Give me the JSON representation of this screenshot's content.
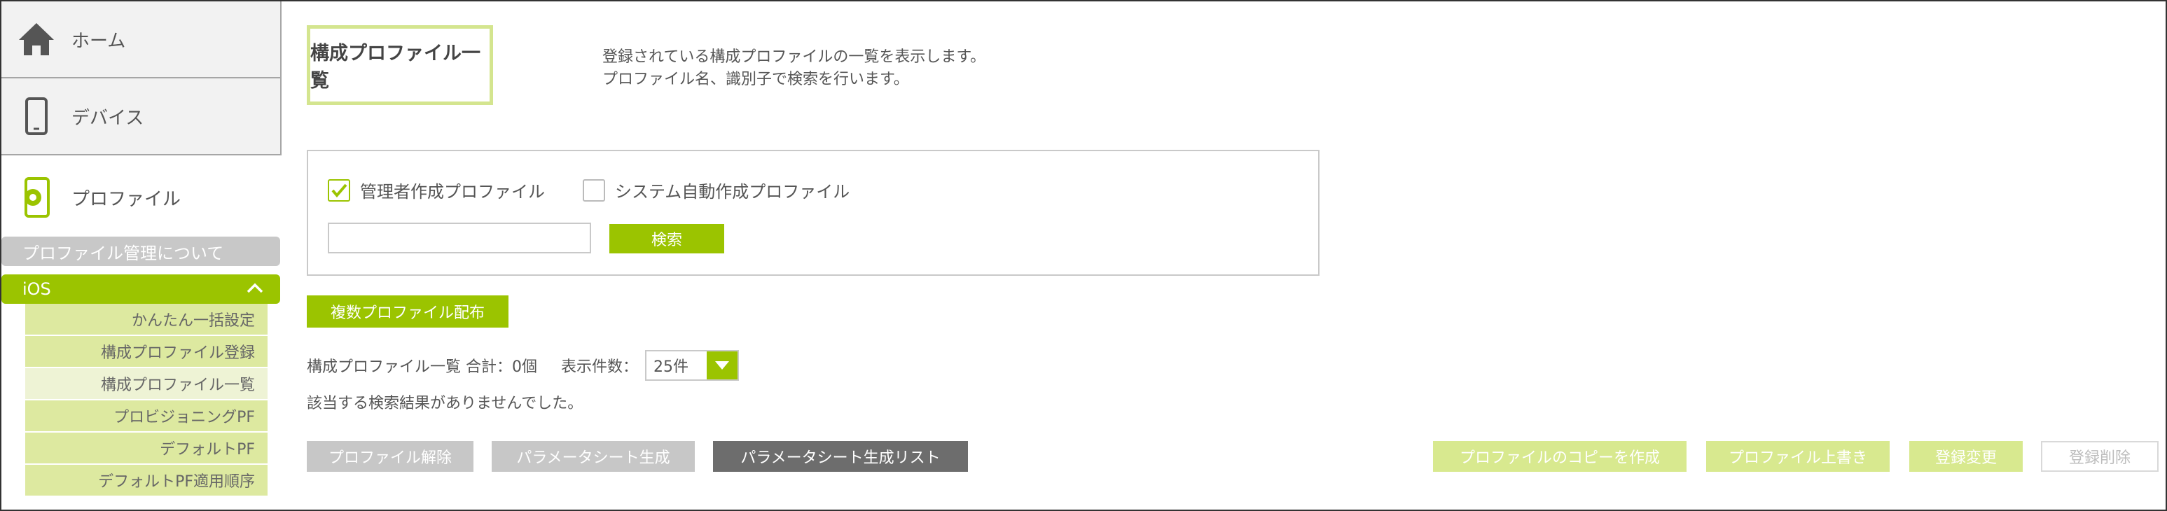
{
  "sidebar": {
    "home_label": "ホーム",
    "device_label": "デバイス",
    "profile_label": "プロファイル",
    "about_label": "プロファイル管理について",
    "ios_label": "iOS",
    "sub_items": [
      {
        "label": "かんたん一括設定"
      },
      {
        "label": "構成プロファイル登録"
      },
      {
        "label": "構成プロファイル一覧"
      },
      {
        "label": "プロビジョニングPF"
      },
      {
        "label": "デフォルトPF"
      },
      {
        "label": "デフォルトPF適用順序"
      }
    ]
  },
  "main": {
    "title": "構成プロファイル一覧",
    "description_line1": "登録されている構成プロファイルの一覧を表示します。",
    "description_line2": "プロファイル名、識別子で検索を行います。",
    "filter": {
      "admin_label": "管理者作成プロファイル",
      "admin_checked": true,
      "system_label": "システム自動作成プロファイル",
      "system_checked": false,
      "search_value": "",
      "search_button": "検索"
    },
    "multi_deploy_button": "複数プロファイル配布",
    "count_text": "構成プロファイル一覧 合計：0個",
    "per_page_label": "表示件数：",
    "per_page_value": "25件",
    "no_result_text": "該当する検索結果がありませんでした。",
    "actions": {
      "release": "プロファイル解除",
      "param_sheet": "パラメータシート生成",
      "param_sheet_list": "パラメータシート生成リスト",
      "copy": "プロファイルのコピーを作成",
      "overwrite": "プロファイル上書き",
      "edit": "登録変更",
      "delete": "登録削除"
    }
  },
  "colors": {
    "accent_green": "#9bc400",
    "light_green": "#dde9a0",
    "title_border": "#d4e58f"
  }
}
